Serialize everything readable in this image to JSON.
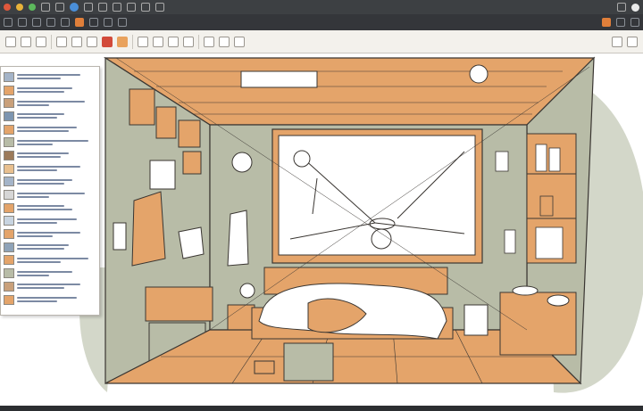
{
  "colors": {
    "titlebar": "#3d4043",
    "toolbar": "#34363a",
    "ribbon": "#f3f1ec",
    "wood": "#e4a46a",
    "wall": "#b8bca7",
    "line": "#3a3632",
    "blob": "#d3d7c9",
    "window": "#ffffff",
    "accent": "#e07f3a"
  },
  "icons": {
    "window_controls": [
      "close-dot",
      "minimize-dot",
      "maximize-dot"
    ],
    "toolbar": [
      "back-icon",
      "forward-icon",
      "reload-icon",
      "home-icon",
      "bookmark-icon",
      "brush-icon",
      "layers-icon",
      "settings-icon"
    ],
    "ribbon": [
      "select-icon",
      "pen-icon",
      "eraser-icon",
      "color-icon",
      "shape-icon",
      "text-icon",
      "zoom-icon"
    ]
  },
  "sidebar": {
    "items": [
      {
        "icon": "thumbnail-icon",
        "color": "#a4b4c8"
      },
      {
        "icon": "thumbnail-icon",
        "color": "#e4a46a"
      },
      {
        "icon": "thumbnail-icon",
        "color": "#c9a07a"
      },
      {
        "icon": "thumbnail-icon",
        "color": "#7d95b0"
      },
      {
        "icon": "thumbnail-icon",
        "color": "#e4a46a"
      },
      {
        "icon": "thumbnail-icon",
        "color": "#b8bca7"
      },
      {
        "icon": "thumbnail-icon",
        "color": "#9b7a5a"
      },
      {
        "icon": "thumbnail-icon",
        "color": "#e9c08f"
      },
      {
        "icon": "thumbnail-icon",
        "color": "#a4b4c8"
      },
      {
        "icon": "thumbnail-icon",
        "color": "#d6d6d6"
      },
      {
        "icon": "thumbnail-icon",
        "color": "#e4a46a"
      },
      {
        "icon": "thumbnail-icon",
        "color": "#c8d4e0"
      },
      {
        "icon": "thumbnail-icon",
        "color": "#e4a46a"
      },
      {
        "icon": "thumbnail-icon",
        "color": "#8fa3b8"
      },
      {
        "icon": "thumbnail-icon",
        "color": "#e4a46a"
      },
      {
        "icon": "thumbnail-icon",
        "color": "#b8bca7"
      },
      {
        "icon": "thumbnail-icon",
        "color": "#c9a07a"
      },
      {
        "icon": "thumbnail-icon",
        "color": "#e4a46a"
      }
    ]
  }
}
